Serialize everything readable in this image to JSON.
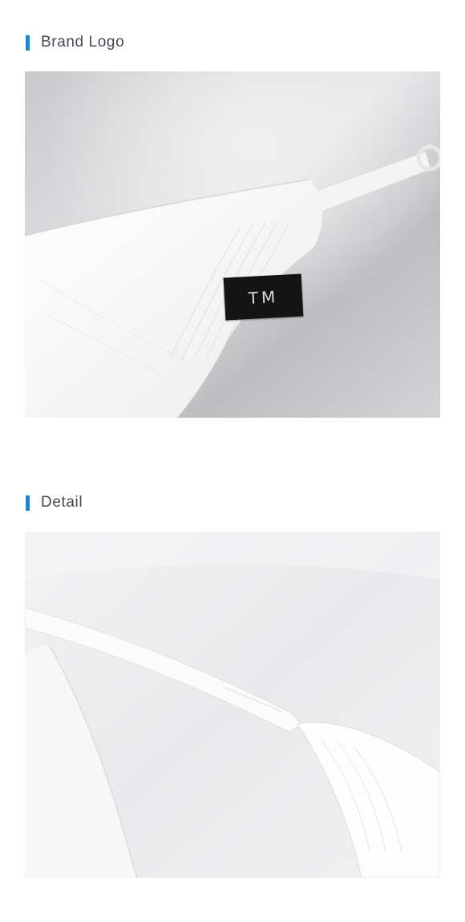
{
  "sections": [
    {
      "title": "Brand Logo",
      "tag_text": "TM"
    },
    {
      "title": "Detail"
    }
  ],
  "colors": {
    "accent": "#1a86d8",
    "title_text": "#444a52",
    "background": "#ffffff"
  }
}
